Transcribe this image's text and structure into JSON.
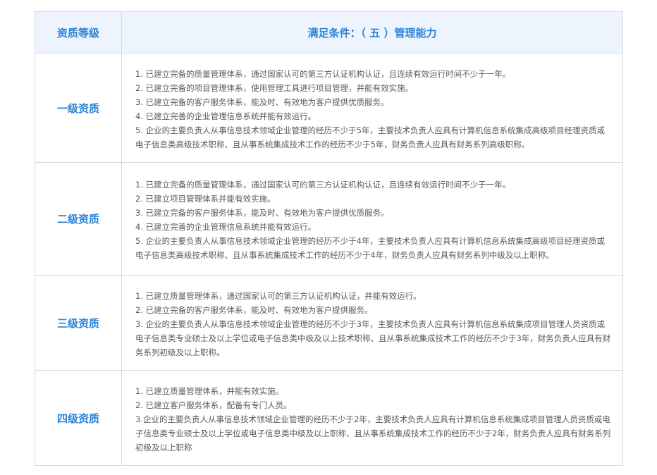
{
  "header": {
    "level_label": "资质等级",
    "condition_label": "满足条件：（ 五 ）管理能力"
  },
  "rows": [
    {
      "level": "一级资质",
      "items": [
        "1. 已建立完备的质量管理体系，通过国家认可的第三方认证机构认证，且连续有效运行时间不少于一年。",
        "2. 已建立完备的项目管理体系，使用管理工具进行项目管理，并能有效实施。",
        "3. 已建立完备的客户服务体系，能及时、有效地为客户提供优质服务。",
        "4. 已建立完善的企业管理信息系统并能有效运行。",
        "5. 企业的主要负责人从事信息技术领域企业管理的经历不少于5年，主要技术负责人应具有计算机信息系统集成高级项目经理资质或电子信息类高级技术职称、且从事系统集成技术工作的经历不少于5年，财务负责人应具有财务系列高级职称。"
      ]
    },
    {
      "level": "二级资质",
      "items": [
        "1. 已建立完备的质量管理体系，通过国家认可的第三方认证机构认证，且连续有效运行时间不少于一年。",
        "2. 已建立项目管理体系并能有效实施。",
        "3. 已建立完备的客户服务体系，能及时、有效地为客户提供优质服务。",
        "4. 已建立完善的企业管理信息系统并能有效运行。",
        "5. 企业的主要负责人从事信息技术领域企业管理的经历不少于4年，主要技术负责人应具有计算机信息系统集成高级项目经理资质或电子信息类高级技术职称、且从事系统集成技术工作的经历不少于4年，财务负责人应具有财务系列中级及以上职称。"
      ]
    },
    {
      "level": "三级资质",
      "items": [
        "1. 已建立质量管理体系，通过国家认可的第三方认证机构认证，并能有效运行。",
        "2. 已建立完备的客户服务体系，能及时、有效地为客户提供服务。",
        "3. 企业的主要负责人从事信息技术领域企业管理的经历不少于3年，主要技术负责人应具有计算机信息系统集成项目管理人员资质或电子信息类专业硕士及以上学位或电子信息类中级及以上技术职称、且从事系统集成技术工作的经历不少于3年，财务负责人应具有财务系列初级及以上职称。"
      ]
    },
    {
      "level": "四级资质",
      "items": [
        "1. 已建立质量管理体系，并能有效实施。",
        "2. 已建立客户服务体系，配备有专门人员。",
        "3.企业的主要负责人从事信息技术领域企业管理的经历不少于2年，主要技术负责人应具有计算机信息系统集成项目管理人员资质或电子信息类专业硕士及以上学位或电子信息类中级及以上职称、且从事系统集成技术工作的经历不少于2年，财务负责人应具有财务系列初级及以上职称"
      ]
    }
  ]
}
